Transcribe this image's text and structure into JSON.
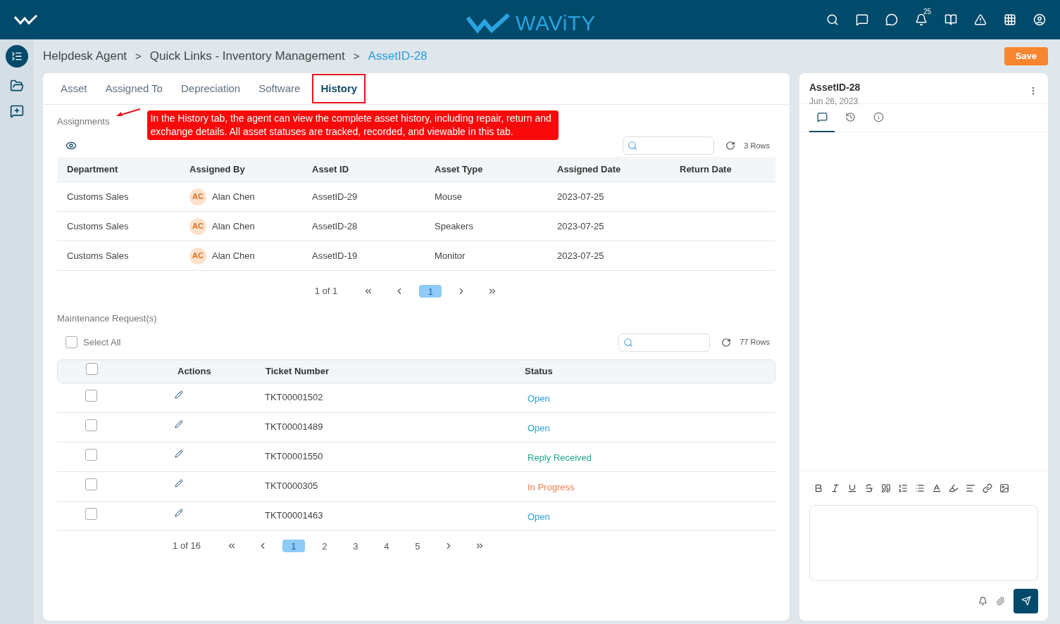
{
  "topbar": {
    "logo_text": "WAViTY",
    "notification_count": "25"
  },
  "breadcrumb": [
    {
      "label": "Helpdesk Agent",
      "current": false
    },
    {
      "label": "Quick Links - Inventory Management",
      "current": false
    },
    {
      "label": "AssetID-28",
      "current": true
    }
  ],
  "breadcrumb_separator": ">",
  "save_button": "Save",
  "tabs": [
    {
      "label": "Asset",
      "selected": false
    },
    {
      "label": "Assigned To",
      "selected": false
    },
    {
      "label": "Depreciation",
      "selected": false
    },
    {
      "label": "Software",
      "selected": false
    },
    {
      "label": "History",
      "selected": true
    }
  ],
  "annotation": "In the History tab, the agent can view the complete asset history, including repair, return and exchange details. All asset statuses are tracked, recorded, and viewable in this tab.",
  "assignments": {
    "title": "Assignments",
    "rows_count": "3 Rows",
    "columns": [
      "Department",
      "Assigned By",
      "Asset ID",
      "Asset Type",
      "Assigned Date",
      "Return Date"
    ],
    "rows": [
      {
        "department": "Customs Sales",
        "initials": "AC",
        "assigned_by": "Alan Chen",
        "asset_id": "AssetID-29",
        "asset_type": "Mouse",
        "assigned_date": "2023-07-25"
      },
      {
        "department": "Customs Sales",
        "initials": "AC",
        "assigned_by": "Alan Chen",
        "asset_id": "AssetID-28",
        "asset_type": "Speakers",
        "assigned_date": "2023-07-25"
      },
      {
        "department": "Customs Sales",
        "initials": "AC",
        "assigned_by": "Alan Chen",
        "asset_id": "AssetID-19",
        "asset_type": "Monitor",
        "assigned_date": "2023-07-25"
      }
    ],
    "pagination": {
      "summary": "1 of 1",
      "pages": [
        {
          "label": "1",
          "selected": true
        }
      ]
    }
  },
  "maintenance": {
    "title": "Maintenance Request(s)",
    "select_all": {
      "label": "Select All",
      "checked": false
    },
    "rows_count": "77 Rows",
    "columns": [
      "Actions",
      "Ticket Number",
      "Status"
    ],
    "header_checked": false,
    "rows": [
      {
        "checked": false,
        "ticket": "TKT00001502",
        "status": "Open",
        "color": "#2a9fd6"
      },
      {
        "checked": false,
        "ticket": "TKT00001489",
        "status": "Open",
        "color": "#2a9fd6"
      },
      {
        "checked": false,
        "ticket": "TKT00001550",
        "status": "Reply Received",
        "color": "#1fa88a"
      },
      {
        "checked": false,
        "ticket": "TKT0000305",
        "status": "In Progress",
        "color": "#f07c4e"
      },
      {
        "checked": false,
        "ticket": "TKT00001463",
        "status": "Open",
        "color": "#2a9fd6"
      }
    ],
    "pagination": {
      "summary": "1 of 16",
      "pages": [
        {
          "label": "1",
          "selected": true
        },
        {
          "label": "2",
          "selected": false
        },
        {
          "label": "3",
          "selected": false
        },
        {
          "label": "4",
          "selected": false
        },
        {
          "label": "5",
          "selected": false
        }
      ]
    }
  },
  "side_panel": {
    "title": "AssetID-28",
    "date": "Jun 26, 2023",
    "tabs": [
      {
        "kind": "comments",
        "selected": true
      },
      {
        "kind": "history",
        "selected": false
      },
      {
        "kind": "info",
        "selected": false
      }
    ]
  }
}
